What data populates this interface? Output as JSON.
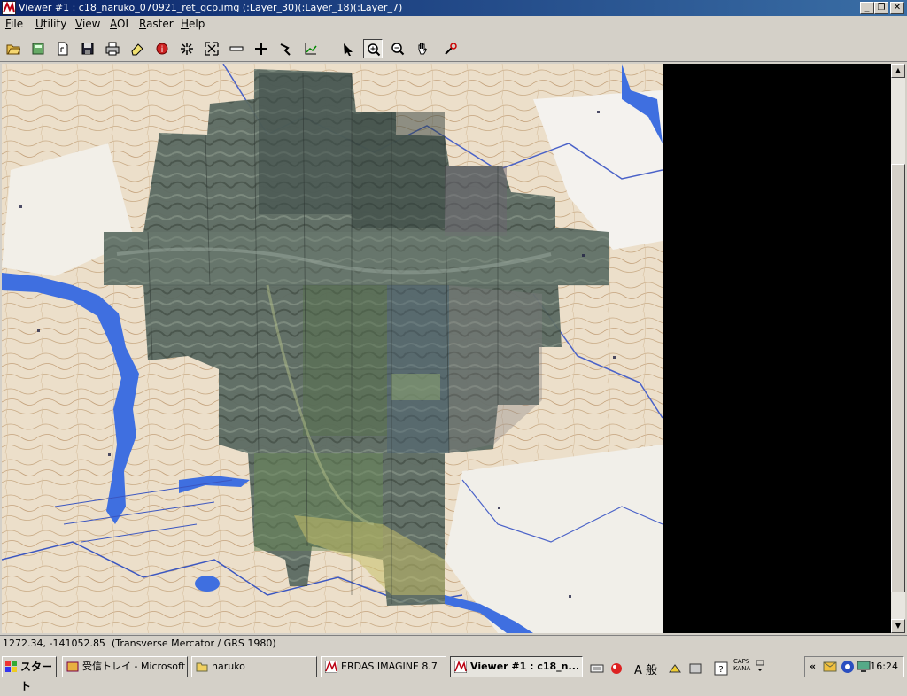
{
  "window": {
    "title": "Viewer #1 : c18_naruko_070921_ret_gcp.img (:Layer_30)(:Layer_18)(:Layer_7)",
    "minimize_label": "_",
    "maximize_label": "❐",
    "close_label": "✕"
  },
  "menu": {
    "items": [
      "File",
      "Utility",
      "View",
      "AOI",
      "Raster",
      "Help"
    ]
  },
  "toolbar": {
    "tools": [
      "open-layer",
      "open-folder",
      "new-file",
      "save",
      "print",
      "clear-layer",
      "info",
      "zoom-in-2x",
      "fit-to-window",
      "measure-ruler",
      "inquire-cursor",
      "profile-tool",
      "histogram",
      "select",
      "zoom-in",
      "zoom-out",
      "pan",
      "inquire"
    ],
    "active_tool": "zoom-in"
  },
  "status": {
    "coords": "1272.34, -141052.85",
    "projection": "(Transverse Mercator / GRS 1980)"
  },
  "taskbar": {
    "start_label": "スタート",
    "tasks": [
      {
        "label": "受信トレイ - Microsoft ...",
        "active": false
      },
      {
        "label": "naruko",
        "active": false
      },
      {
        "label": "ERDAS IMAGINE 8.7",
        "active": false
      },
      {
        "label": "Viewer #1 : c18_n...",
        "active": true
      }
    ],
    "ime_char": "A 般",
    "caps_label": "CAPS",
    "kana_label": "KANA",
    "tray_chevron": "«",
    "clock": "16:24"
  },
  "colors": {
    "titlebar": "#0a246a",
    "chrome": "#d4d0c8",
    "water": "#3f6fe0",
    "terrain": "#e7dbc6",
    "image_dark": "#4a5a55"
  }
}
